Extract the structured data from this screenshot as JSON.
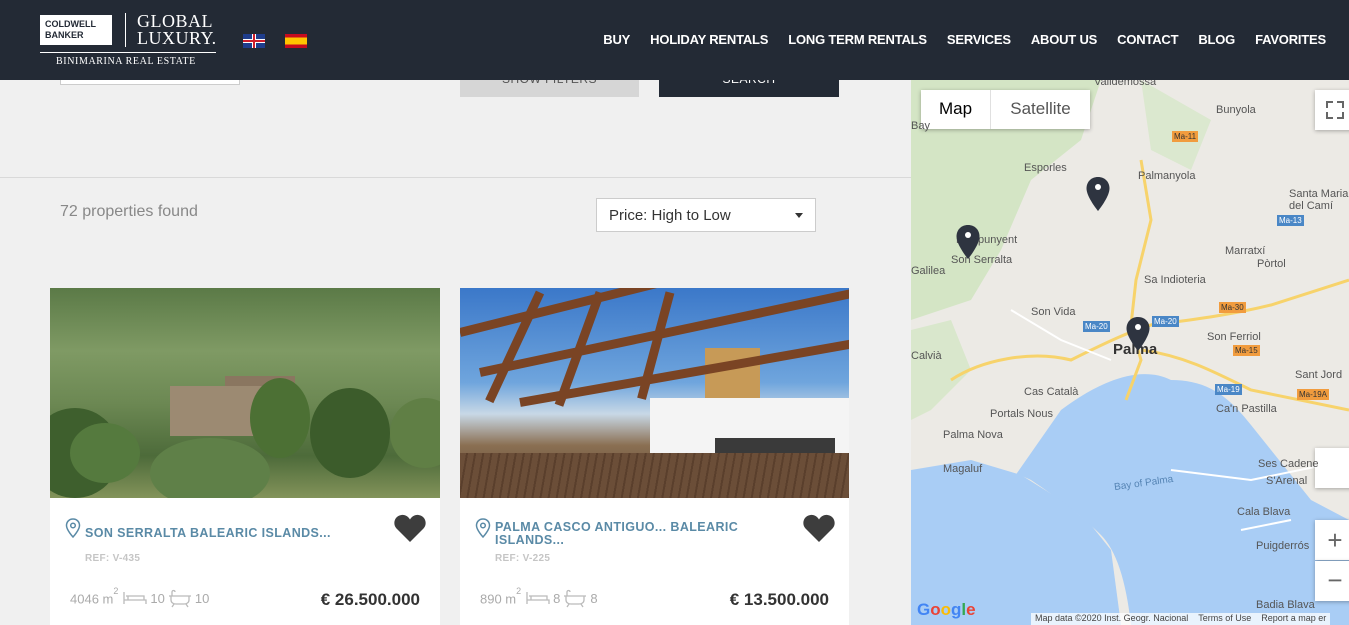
{
  "header": {
    "logo_cb": "COLDWELL BANKER",
    "logo_gl_line1": "GLOBAL",
    "logo_gl_line2": "LUXURY.",
    "logo_sub": "BINIMARINA REAL ESTATE",
    "flags": [
      "uk-flag-icon",
      "spain-flag-icon"
    ],
    "nav": [
      "BUY",
      "HOLIDAY RENTALS",
      "LONG TERM RENTALS",
      "SERVICES",
      "ABOUT US",
      "CONTACT",
      "BLOG",
      "FAVORITES"
    ],
    "bg_color": "#232a35"
  },
  "filters": {
    "show_filters": "SHOW FILTERS",
    "search": "SEARCH"
  },
  "results": {
    "count_text": "72 properties found",
    "sort_value": "Price: High to Low"
  },
  "listings": [
    {
      "title": "SON SERRALTA BALEARIC ISLANDS...",
      "ref": "REF: V-435",
      "area": "4046 m",
      "area_sup": "2",
      "beds": "10",
      "baths": "10",
      "price": "€ 26.500.000"
    },
    {
      "title": "PALMA CASCO ANTIGUO... BALEARIC ISLANDS...",
      "ref": "REF: V-225",
      "area": "890 m",
      "area_sup": "2",
      "beds": "8",
      "baths": "8",
      "price": "€ 13.500.000"
    }
  ],
  "map": {
    "type_map": "Map",
    "type_satellite": "Satellite",
    "places": [
      "Valldemossa",
      "Bunyola",
      "Esporles",
      "Palmanyola",
      "Santa Maria del Camí",
      "Puigpunyent",
      "Son Serralta",
      "Marratxí",
      "Galilea",
      "Sa Indioteria",
      "Pòrtol",
      "Son Vida",
      "Palma",
      "Son Ferriol",
      "Calvià",
      "Cas Català",
      "Sant Jord",
      "Portals Nous",
      "Ca'n Pastilla",
      "Palma Nova",
      "Magaluf",
      "Ses Cadene",
      "S'Arenal",
      "Bay of Palma",
      "Cala Blava",
      "Puigderrós",
      "Badia Blava",
      "Bay"
    ],
    "roads": [
      "Ma-11",
      "Ma-13",
      "Ma-30",
      "Ma-20",
      "Ma-20",
      "Ma-15",
      "Ma-19",
      "Ma-19A"
    ],
    "google": "Google",
    "attribution": "Map data ©2020 Inst. Geogr. Nacional",
    "terms": "Terms of Use",
    "report": "Report a map er",
    "zoom_in": "+",
    "zoom_out": "−"
  }
}
